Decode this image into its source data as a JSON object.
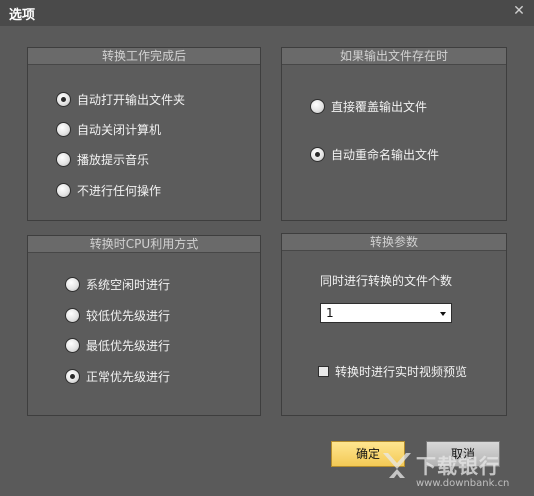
{
  "window": {
    "title": "选项"
  },
  "after_convert": {
    "title": "转换工作完成后",
    "options": [
      "自动打开输出文件夹",
      "自动关闭计算机",
      "播放提示音乐",
      "不进行任何操作"
    ],
    "selected_index": 0
  },
  "if_exists": {
    "title": "如果输出文件存在时",
    "options": [
      "直接覆盖输出文件",
      "自动重命名输出文件"
    ],
    "selected_index": 1
  },
  "cpu_usage": {
    "title": "转换时CPU利用方式",
    "options": [
      "系统空闲时进行",
      "较低优先级进行",
      "最低优先级进行",
      "正常优先级进行"
    ],
    "selected_index": 3
  },
  "convert_params": {
    "title": "转换参数",
    "concurrent_label": "同时进行转换的文件个数",
    "concurrent_value": "1",
    "preview_label": "转换时进行实时视频预览",
    "preview_checked": false
  },
  "buttons": {
    "ok": "确定",
    "cancel": "取消"
  },
  "watermark": {
    "text": "下载银行",
    "url": "www.downbank.cn"
  }
}
